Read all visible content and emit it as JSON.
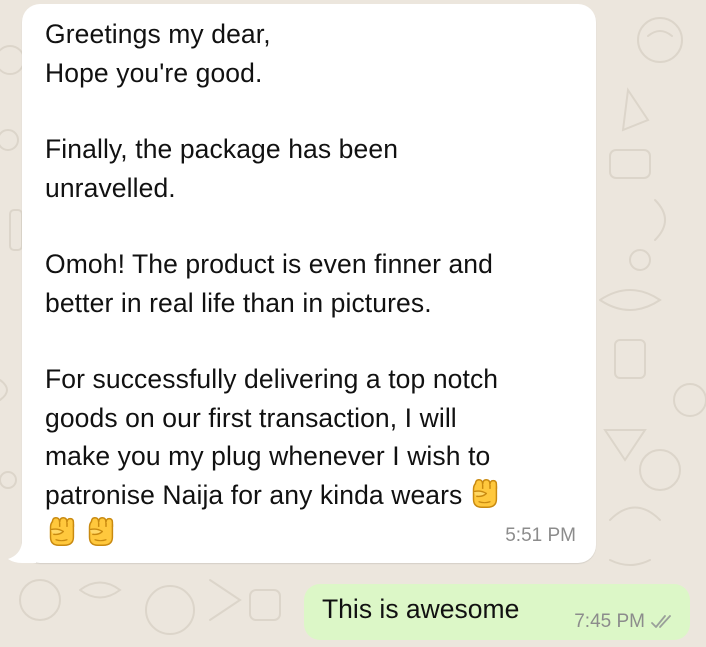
{
  "chat": {
    "incoming": {
      "paragraphs": [
        [
          "Greetings my dear,",
          "Hope you're good."
        ],
        [
          "Finally, the package has been",
          "unravelled."
        ],
        [
          "Omoh! The product is even finner and",
          "better in real life than in pictures."
        ],
        [
          "For successfully delivering a top notch",
          "goods on our first transaction, I will",
          "make you my plug whenever I wish to",
          "patronise Naija for any kinda wears"
        ]
      ],
      "emoji": "raised-fist",
      "emoji_count": 3,
      "time": "5:51 PM"
    },
    "outgoing": {
      "text": "This is awesome",
      "time": "7:45 PM",
      "status": "delivered"
    }
  },
  "colors": {
    "wallpaper": "#ece6dd",
    "incoming_bubble": "#ffffff",
    "outgoing_bubble": "#dcf7c7",
    "text": "#111111",
    "timestamp": "#8c8c8c",
    "fist": "#ffc83d"
  }
}
